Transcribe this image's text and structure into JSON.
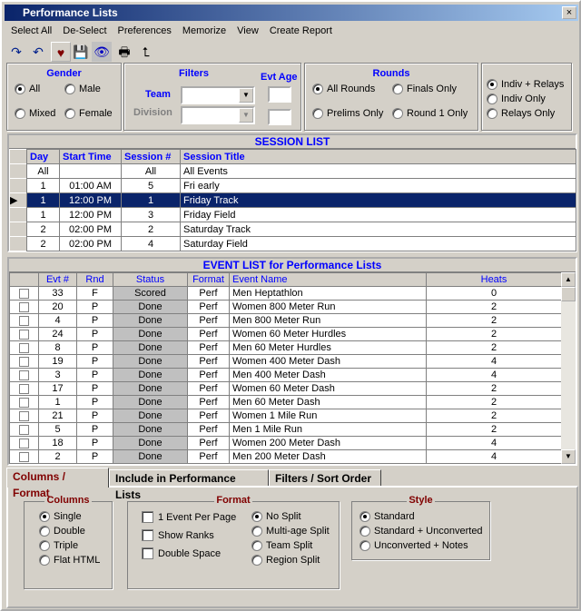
{
  "window": {
    "title": "Performance Lists",
    "close": "×"
  },
  "menu": [
    "Select All",
    "De-Select",
    "Preferences",
    "Memorize",
    "View",
    "Create Report"
  ],
  "toolbar": [
    {
      "icon": "redo-icon",
      "g": "↷"
    },
    {
      "icon": "undo-icon",
      "g": "↶"
    },
    {
      "icon": "heart-icon",
      "g": "♥"
    },
    {
      "icon": "save-disk-icon",
      "g": "💾"
    },
    {
      "icon": "eye-icon",
      "g": "👁"
    },
    {
      "icon": "printer-icon",
      "g": "🖶"
    },
    {
      "icon": "folder-up-icon",
      "g": "⮤"
    }
  ],
  "gender": {
    "title": "Gender",
    "options": [
      {
        "label": "All",
        "checked": true
      },
      {
        "label": "Male",
        "checked": false
      },
      {
        "label": "Mixed",
        "checked": false
      },
      {
        "label": "Female",
        "checked": false
      }
    ]
  },
  "filters": {
    "title": "Filters",
    "team_label": "Team",
    "team_value": "",
    "division_label": "Division",
    "division_value": "",
    "evt_age_label": "Evt Age",
    "evt_age_from": "",
    "evt_age_to": ""
  },
  "rounds": {
    "title": "Rounds",
    "options": [
      {
        "label": "All Rounds",
        "checked": true
      },
      {
        "label": "Finals Only",
        "checked": false
      },
      {
        "label": "Prelims Only",
        "checked": false
      },
      {
        "label": "Round 1 Only",
        "checked": false
      }
    ]
  },
  "event_type": {
    "options": [
      {
        "label": "Indiv + Relays",
        "checked": true
      },
      {
        "label": "Indiv Only",
        "checked": false
      },
      {
        "label": "Relays Only",
        "checked": false
      }
    ]
  },
  "session_list": {
    "title": "SESSION LIST",
    "columns": [
      "Day",
      "Start Time",
      "Session #",
      "Session Title"
    ],
    "rows": [
      [
        "All",
        "",
        "All",
        "All Events"
      ],
      [
        "1",
        "01:00 AM",
        "5",
        "Fri early"
      ],
      [
        "1",
        "12:00 PM",
        "1",
        "Friday Track"
      ],
      [
        "1",
        "12:00 PM",
        "3",
        "Friday Field"
      ],
      [
        "2",
        "02:00 PM",
        "2",
        "Saturday Track"
      ],
      [
        "2",
        "02:00 PM",
        "4",
        "Saturday Field"
      ]
    ],
    "selected_index": 2
  },
  "event_list": {
    "title": "EVENT LIST for Performance Lists",
    "columns": [
      "",
      "Evt #",
      "Rnd",
      "Status",
      "Format",
      "Event Name",
      "Heats"
    ],
    "rows": [
      [
        "33",
        "F",
        "Scored",
        "Perf",
        "Men Heptathlon",
        "0"
      ],
      [
        "20",
        "P",
        "Done",
        "Perf",
        "Women 800 Meter Run",
        "2"
      ],
      [
        "4",
        "P",
        "Done",
        "Perf",
        "Men 800 Meter Run",
        "2"
      ],
      [
        "24",
        "P",
        "Done",
        "Perf",
        "Women 60 Meter Hurdles",
        "2"
      ],
      [
        "8",
        "P",
        "Done",
        "Perf",
        "Men 60 Meter Hurdles",
        "2"
      ],
      [
        "19",
        "P",
        "Done",
        "Perf",
        "Women 400 Meter Dash",
        "4"
      ],
      [
        "3",
        "P",
        "Done",
        "Perf",
        "Men 400 Meter Dash",
        "4"
      ],
      [
        "17",
        "P",
        "Done",
        "Perf",
        "Women 60 Meter Dash",
        "2"
      ],
      [
        "1",
        "P",
        "Done",
        "Perf",
        "Men 60 Meter Dash",
        "2"
      ],
      [
        "21",
        "P",
        "Done",
        "Perf",
        "Women 1 Mile Run",
        "2"
      ],
      [
        "5",
        "P",
        "Done",
        "Perf",
        "Men 1 Mile Run",
        "2"
      ],
      [
        "18",
        "P",
        "Done",
        "Perf",
        "Women 200 Meter Dash",
        "4"
      ],
      [
        "2",
        "P",
        "Done",
        "Perf",
        "Men 200 Meter Dash",
        "4"
      ]
    ]
  },
  "tabs": [
    {
      "label": "Columns / Format",
      "active": true
    },
    {
      "label": "Include in Performance Lists",
      "active": false
    },
    {
      "label": "Filters / Sort Order",
      "active": false
    }
  ],
  "columns_group": {
    "title": "Columns",
    "options": [
      {
        "label": "Single",
        "checked": true
      },
      {
        "label": "Double",
        "checked": false
      },
      {
        "label": "Triple",
        "checked": false
      },
      {
        "label": "Flat HTML",
        "checked": false
      }
    ]
  },
  "format_group": {
    "title": "Format",
    "checks": [
      {
        "label": "1 Event Per Page",
        "checked": false
      },
      {
        "label": "Show Ranks",
        "checked": false
      },
      {
        "label": "Double Space",
        "checked": false
      }
    ],
    "splits": [
      {
        "label": "No Split",
        "checked": true
      },
      {
        "label": "Multi-age Split",
        "checked": false
      },
      {
        "label": "Team Split",
        "checked": false
      },
      {
        "label": "Region Split",
        "checked": false
      }
    ]
  },
  "style_group": {
    "title": "Style",
    "options": [
      {
        "label": "Standard",
        "checked": true
      },
      {
        "label": "Standard + Unconverted",
        "checked": false
      },
      {
        "label": "Unconverted + Notes",
        "checked": false
      }
    ]
  },
  "colors": {
    "accent": "#0000ff",
    "selection": "#0a246a",
    "tab_active": "#800000"
  }
}
